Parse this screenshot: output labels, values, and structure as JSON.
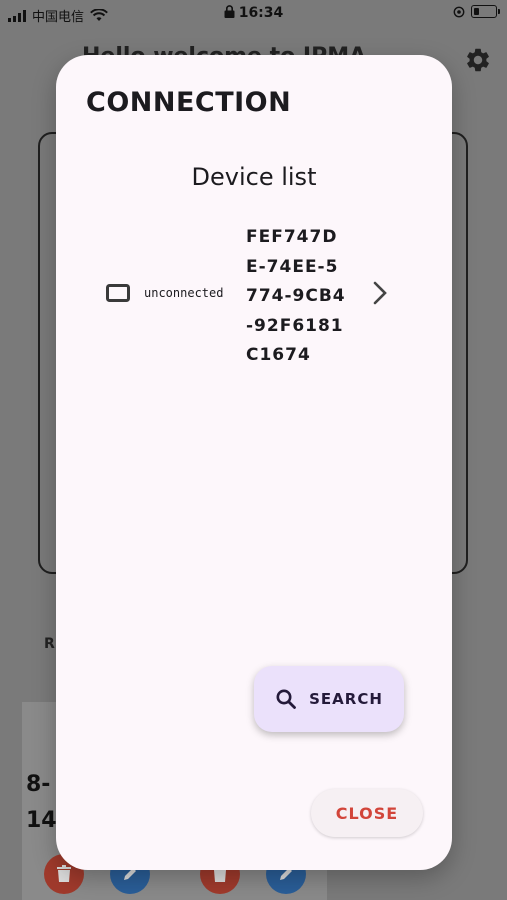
{
  "status_bar": {
    "carrier": "中国电信",
    "time": "16:34"
  },
  "background": {
    "title": "Hello welcome to IPMA",
    "section_label": "R",
    "row_text_1": "8-",
    "row_text_2": "14:"
  },
  "dialog": {
    "title": "CONNECTION",
    "list_heading": "Device list",
    "devices": [
      {
        "status": "unconnected",
        "id": "FEF747DE-74EE-5774-9CB4-92F6181C1674"
      }
    ],
    "search_label": "SEARCH",
    "close_label": "CLOSE"
  },
  "colors": {
    "dialog_bg": "#fdf7fb",
    "search_bg": "#ebe1fb",
    "close_text": "#d2453a",
    "scrim": "#7a7a7a"
  },
  "icons": {
    "status_bar": [
      "signal-icon",
      "wifi-icon",
      "lock-icon",
      "alarm-icon",
      "battery-icon"
    ],
    "settings": "gear-icon",
    "device": "device-outline-icon",
    "row_action": "chevron-right-icon",
    "search": "search-icon",
    "delete": "trash-icon",
    "edit": "pencil-icon"
  }
}
